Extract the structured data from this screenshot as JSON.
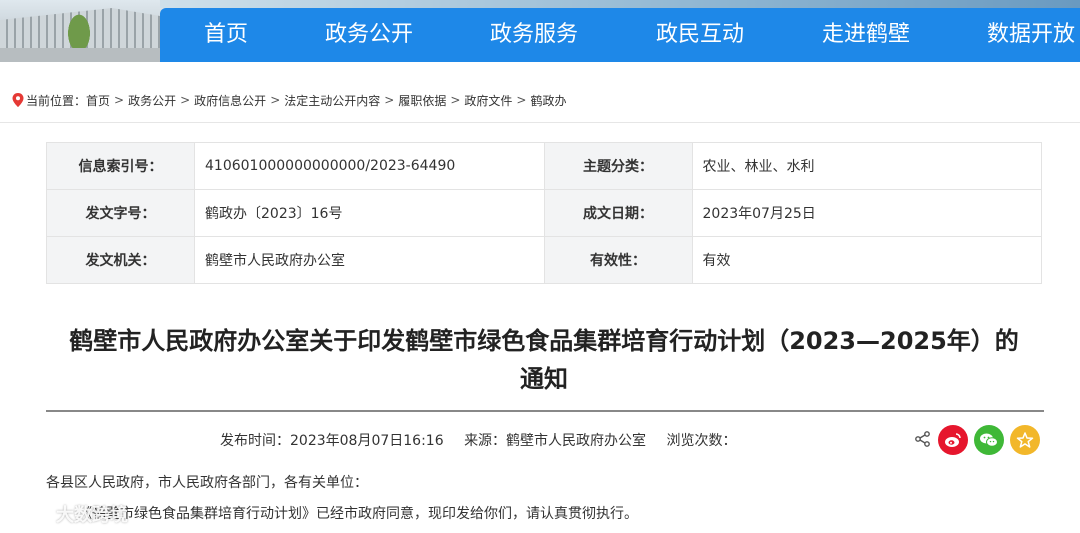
{
  "nav": {
    "items": [
      {
        "label": "首页"
      },
      {
        "label": "政务公开"
      },
      {
        "label": "政务服务"
      },
      {
        "label": "政民互动"
      },
      {
        "label": "走进鹤壁"
      },
      {
        "label": "数据开放"
      }
    ]
  },
  "breadcrumb": {
    "prefix": "当前位置：",
    "items": [
      "首页",
      "政务公开",
      "政府信息公开",
      "法定主动公开内容",
      "履职依据",
      "政府文件",
      "鹤政办"
    ],
    "separator": ">"
  },
  "meta": {
    "index_label": "信息索引号：",
    "index_value": "410601000000000000/2023-64490",
    "topic_label": "主题分类：",
    "topic_value": "农业、林业、水利",
    "docno_label": "发文字号：",
    "docno_value": "鹤政办〔2023〕16号",
    "date_label": "成文日期：",
    "date_value": "2023年07月25日",
    "issuer_label": "发文机关：",
    "issuer_value": "鹤壁市人民政府办公室",
    "validity_label": "有效性：",
    "validity_value": "有效"
  },
  "article": {
    "title_line1": "鹤壁市人民政府办公室关于印发鹤壁市绿色食品集群培育行动计划（2023—2025年）的",
    "title_line2": "通知",
    "publish_time": "发布时间：2023年08月07日16:16",
    "source": "来源：鹤壁市人民政府办公室",
    "views": "浏览次数：",
    "para1": "各县区人民政府，市人民政府各部门，各有关单位：",
    "para2": "《鹤壁市绿色食品集群培育行动计划》已经市政府同意，现印发给你们，请认真贯彻执行。"
  },
  "share": {
    "icons": [
      "share-icon",
      "weibo-icon",
      "wechat-icon",
      "favorite-icon"
    ]
  },
  "watermark": {
    "text": "大数跨境"
  },
  "colors": {
    "nav_bg": "#1e88e8",
    "weibo": "#e6162d",
    "wechat": "#3fb837",
    "favorite": "#f2b72a"
  }
}
